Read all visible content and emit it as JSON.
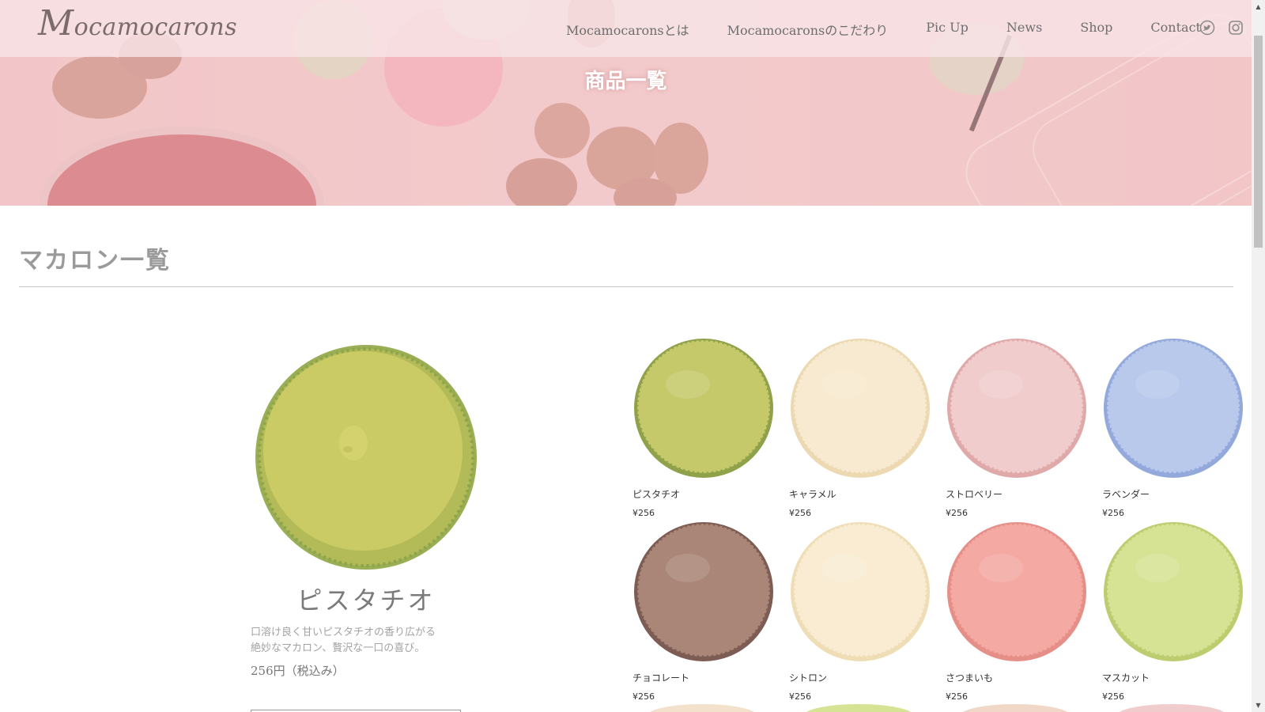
{
  "header": {
    "logo_initial": "M",
    "logo_rest": "ocamocarons",
    "nav": [
      "Mocamocaronsとは",
      "Mocamocaronsのこだわり",
      "Pic Up",
      "News",
      "Shop",
      "Contact"
    ],
    "social_icons": [
      "twitter-icon",
      "instagram-icon"
    ]
  },
  "hero": {
    "title": "商品一覧"
  },
  "section": {
    "title": "マカロン一覧"
  },
  "featured": {
    "name": "ピスタチオ",
    "description_line1": "口溶け良く甘いピスタチオの香り広がる",
    "description_line2": "絶妙なマカロン、贅沢な一口の喜び。",
    "price": "256円（税込み）"
  },
  "products": [
    {
      "name": "ピスタチオ",
      "price": "¥256",
      "color": "#c5c96a",
      "edge": "#8fa24a"
    },
    {
      "name": "キャラメル",
      "price": "¥256",
      "color": "#f7ead0",
      "edge": "#ecd9b2"
    },
    {
      "name": "ストロベリー",
      "price": "¥256",
      "color": "#f1cccc",
      "edge": "#e0a9a9"
    },
    {
      "name": "ラベンダー",
      "price": "¥256",
      "color": "#b9c9ec",
      "edge": "#93a9dc"
    },
    {
      "name": "チョコレート",
      "price": "¥256",
      "color": "#a98677",
      "edge": "#7d5c53"
    },
    {
      "name": "シトロン",
      "price": "¥256",
      "color": "#f9ecd2",
      "edge": "#efddb6"
    },
    {
      "name": "さつまいも",
      "price": "¥256",
      "color": "#f4a9a2",
      "edge": "#e58f88"
    },
    {
      "name": "マスカット",
      "price": "¥256",
      "color": "#d6e394",
      "edge": "#bccd6f"
    }
  ],
  "peek_colors": [
    "#f3e1cc",
    "#d6e394",
    "#f1d7c8",
    "#f1cccc"
  ]
}
